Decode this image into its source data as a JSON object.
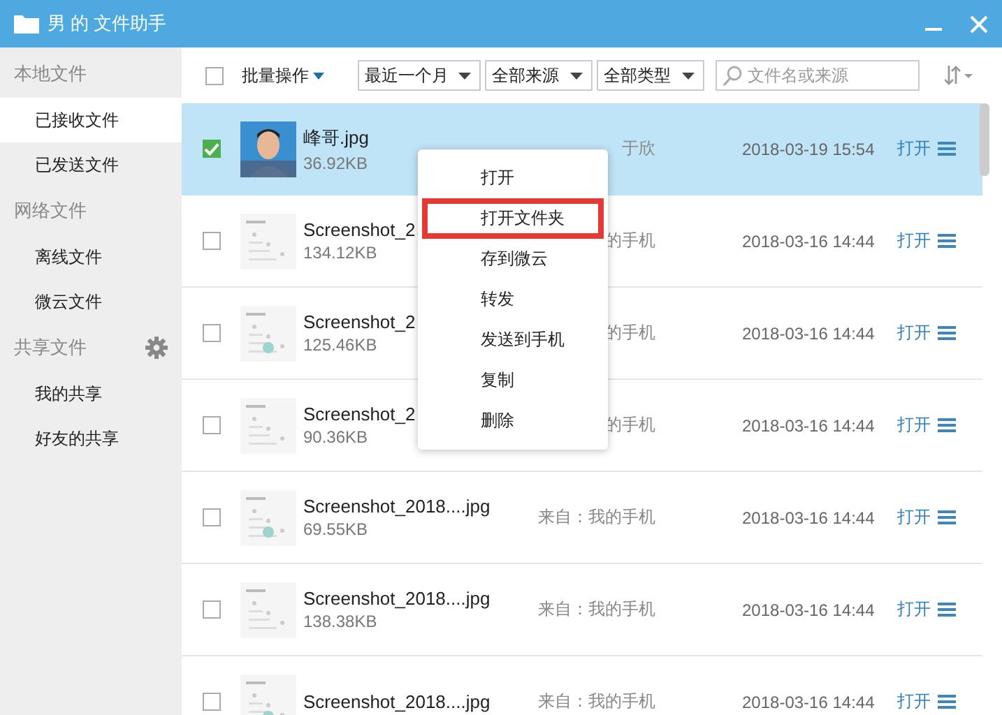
{
  "window": {
    "title": "男 的 文件助手"
  },
  "sidebar": [
    {
      "heading": "本地文件",
      "settings": false,
      "items": [
        {
          "label": "已接收文件",
          "selected": true
        },
        {
          "label": "已发送文件",
          "selected": false
        }
      ]
    },
    {
      "heading": "网络文件",
      "settings": false,
      "items": [
        {
          "label": "离线文件",
          "selected": false
        },
        {
          "label": "微云文件",
          "selected": false
        }
      ]
    },
    {
      "heading": "共享文件",
      "settings": true,
      "items": [
        {
          "label": "我的共享",
          "selected": false
        },
        {
          "label": "好友的共享",
          "selected": false
        }
      ]
    }
  ],
  "toolbar": {
    "select_all": false,
    "batch": "批量操作",
    "filters": [
      "最近一个月",
      "全部来源",
      "全部类型"
    ],
    "search": {
      "placeholder": "文件名或来源"
    }
  },
  "files": [
    {
      "name": "峰哥.jpg",
      "size": "36.92KB",
      "source": "于欣",
      "time": "2018-03-19 15:54",
      "action": "打开",
      "checked": true,
      "selected": true
    },
    {
      "name": "Screenshot_2",
      "size": "134.12KB",
      "source": "的手机",
      "time": "2018-03-16 14:44",
      "action": "打开",
      "checked": false,
      "selected": false
    },
    {
      "name": "Screenshot_2",
      "size": "125.46KB",
      "source": "的手机",
      "time": "2018-03-16 14:44",
      "action": "打开",
      "checked": false,
      "selected": false
    },
    {
      "name": "Screenshot_2",
      "size": "90.36KB",
      "source": "的手机",
      "time": "2018-03-16 14:44",
      "action": "打开",
      "checked": false,
      "selected": false
    },
    {
      "name": "Screenshot_2018....jpg",
      "size": "69.55KB",
      "source": "来自：我的手机",
      "time": "2018-03-16 14:44",
      "action": "打开",
      "checked": false,
      "selected": false
    },
    {
      "name": "Screenshot_2018....jpg",
      "size": "138.38KB",
      "source": "来自：我的手机",
      "time": "2018-03-16 14:44",
      "action": "打开",
      "checked": false,
      "selected": false
    },
    {
      "name": "Screenshot_2018....jpg",
      "source": "来自：我的手机",
      "time": "2018-03-16 14:44",
      "action": "打开",
      "checked": false,
      "selected": false
    }
  ],
  "context_menu": [
    {
      "label": "打开",
      "highlighted": false
    },
    {
      "label": "打开文件夹",
      "highlighted": true
    },
    {
      "label": "存到微云",
      "highlighted": false
    },
    {
      "label": "转发",
      "highlighted": false
    },
    {
      "label": "发送到手机",
      "highlighted": false
    },
    {
      "label": "复制",
      "highlighted": false
    },
    {
      "label": "删除",
      "highlighted": false
    }
  ]
}
